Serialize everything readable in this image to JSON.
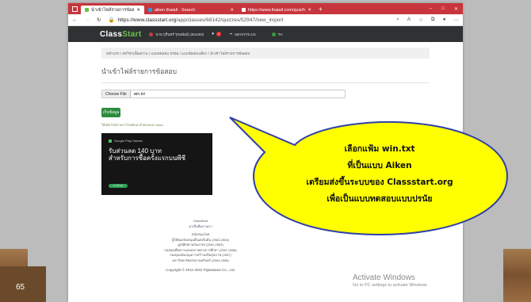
{
  "browser": {
    "tabs": [
      {
        "label": "นำเข้าไฟล์รายการข้อสอบ - ClassSta",
        "active": true
      },
      {
        "label": "aiken thaiall - Search"
      },
      {
        "label": "https://www.thaiall.com/quiz/ht"
      }
    ],
    "url_prefix": "https://www.classstart.org",
    "url_path": "/app/classes/68142/quizzes/52947/new_import",
    "controls": {
      "minimize": "–",
      "maximize": "□",
      "close": "✕"
    }
  },
  "classstart": {
    "logo_a": "Class",
    "logo_b": "Start",
    "user": "นาย บุรินทร์ รุจนพันธุ์ (351093)",
    "notif_count": "0",
    "logout": "ออกจากระบบ",
    "lang": "TH"
  },
  "page": {
    "breadcrumb": "หน้าแรก  /  สหวิชาเพื่อสถาน  /  แบบทดสอบ ปรนัย  /  แบบข้อสอบเดี่ยว  /  นำเข้าไฟล์รายการข้อสอบ",
    "title": "นำเข้าไฟล์รายการข้อสอบ",
    "choose_file": "Choose File",
    "file_name": "win.txt",
    "save": "เก็บข้อมูล",
    "hint": "ให้เลือกไฟล์รายการโจทย์และคำตอบแบบ Aiken"
  },
  "ad": {
    "brand": "Google Play Games",
    "line1": "รับส่วนลด 140 บาท",
    "line2": "สำหรับการซื้อครั้งแรกบนพีซี",
    "cta": "ดาวน์โหลด"
  },
  "footer": {
    "line1": "ClassStart",
    "line2": "มาเป็นทีมงานเรา",
    "support_head": "สนับสนุนโดย",
    "s1": "ผู้ให้ทุนสนับสนุนตั้งแต่เริ่มต้น (2563-2565)",
    "s2": "มูลนิธิสยามกัมมาจล (2561-2563)",
    "s3": "กองทุนเพื่อความเสมอภาคทางการศึกษา (2557-2558)",
    "s4": "กองทุนสนับสนุนการสร้างเสริมสุขภาพ (2557)",
    "s5": "มหาวิทยาลัยสงขลานครินทร์ (2554-2558)",
    "copyright": "Copyright © 2011-2022 Pijawatana Co., Ltd."
  },
  "callout": {
    "line1": "เลือกแฟ้ม win.txt",
    "line2": "ที่เป็นแบบ Aiken",
    "line3": "เตรียมส่งขึ้นระบบของ Classstart.org",
    "line4": "เพื่อเป็นแบบทดสอบแบบปรนัย",
    "fill": "#ffff00"
  },
  "windows": {
    "activate": "Activate Windows",
    "activate_sub": "Go to PC settings to activate Windows."
  },
  "slide_number": "65"
}
